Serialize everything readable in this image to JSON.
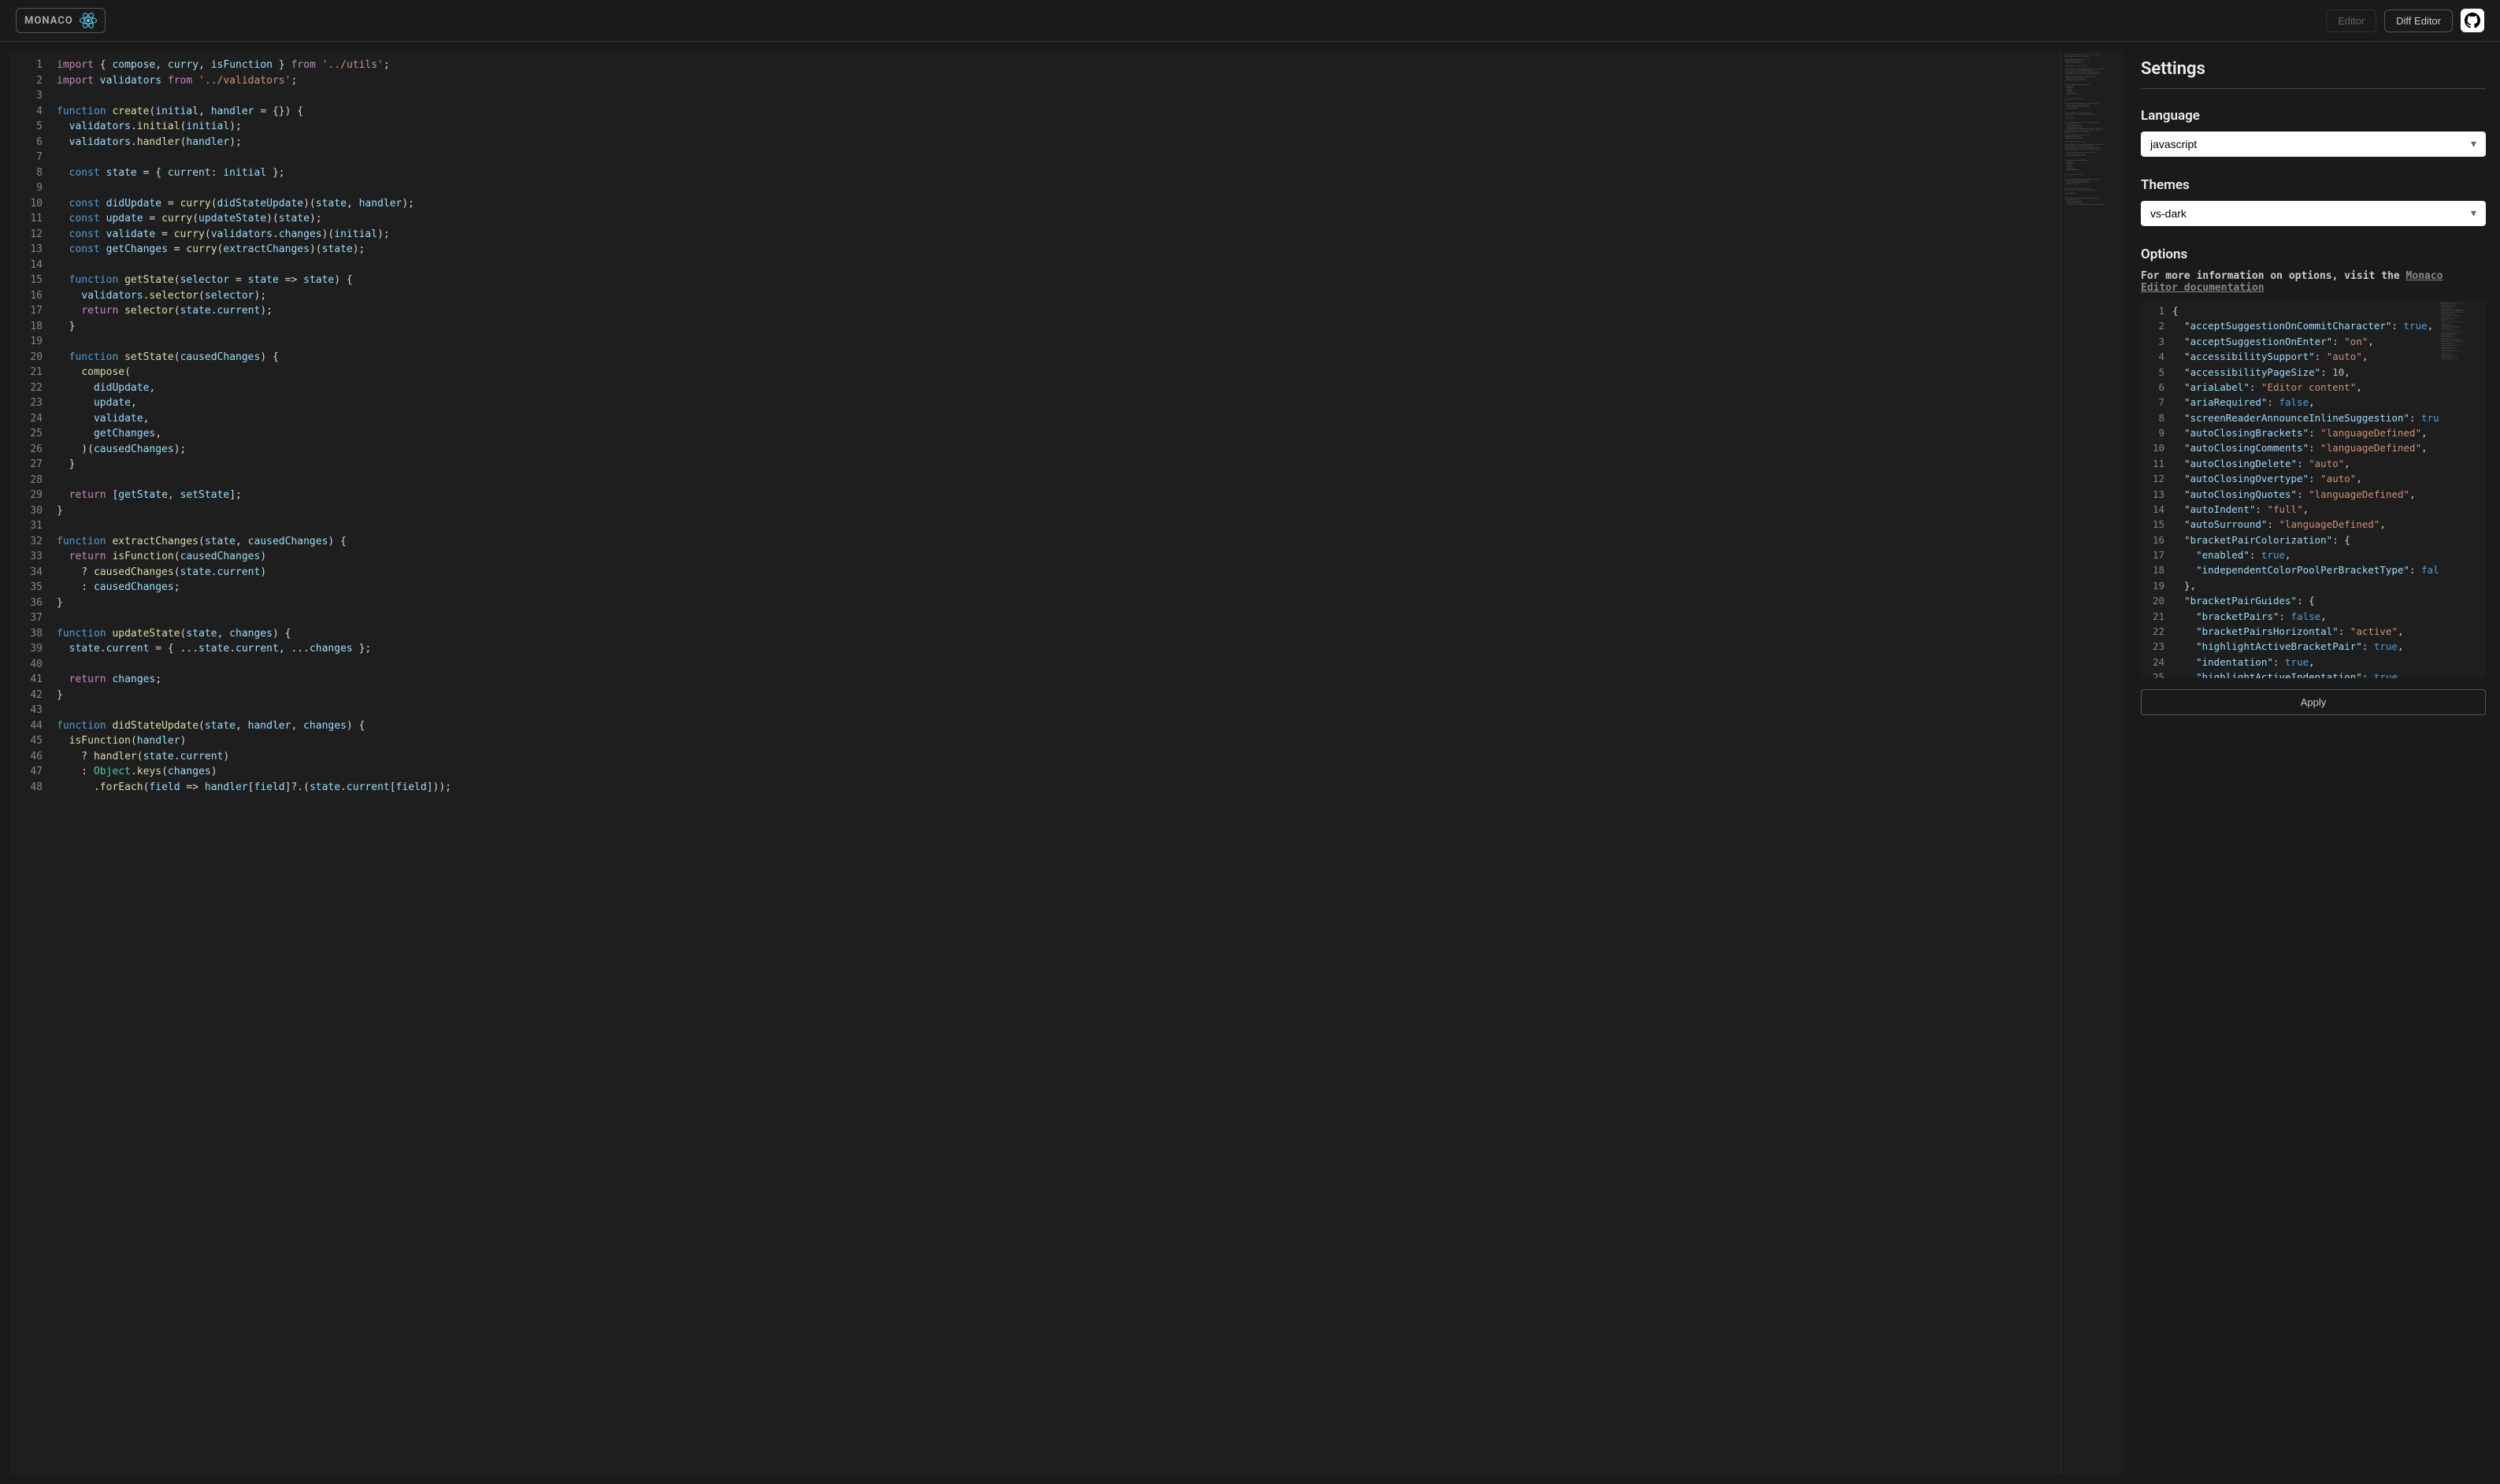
{
  "header": {
    "logo_text": "MONACO",
    "editor_btn": "Editor",
    "diff_btn": "Diff Editor"
  },
  "settings": {
    "title": "Settings",
    "language_label": "Language",
    "language_value": "javascript",
    "themes_label": "Themes",
    "themes_value": "vs-dark",
    "options_label": "Options",
    "options_info_prefix": "For more information on options, visit the ",
    "options_link_text": "Monaco Editor documentation",
    "apply_label": "Apply"
  },
  "main_code_lines": [
    [
      [
        "kw",
        "import"
      ],
      [
        "punct",
        " { "
      ],
      [
        "prop",
        "compose"
      ],
      [
        "punct",
        ", "
      ],
      [
        "prop",
        "curry"
      ],
      [
        "punct",
        ", "
      ],
      [
        "prop",
        "isFunction"
      ],
      [
        "punct",
        " } "
      ],
      [
        "kw",
        "from"
      ],
      [
        "punct",
        " "
      ],
      [
        "str",
        "'../utils'"
      ],
      [
        "punct",
        ";"
      ]
    ],
    [
      [
        "kw",
        "import"
      ],
      [
        "punct",
        " "
      ],
      [
        "prop",
        "validators"
      ],
      [
        "punct",
        " "
      ],
      [
        "kw",
        "from"
      ],
      [
        "punct",
        " "
      ],
      [
        "str",
        "'../validators'"
      ],
      [
        "punct",
        ";"
      ]
    ],
    [],
    [
      [
        "kw2",
        "function"
      ],
      [
        "punct",
        " "
      ],
      [
        "fn",
        "create"
      ],
      [
        "punct",
        "("
      ],
      [
        "prop",
        "initial"
      ],
      [
        "punct",
        ", "
      ],
      [
        "prop",
        "handler"
      ],
      [
        "punct",
        " = {}) {"
      ]
    ],
    [
      [
        "punct",
        "  "
      ],
      [
        "prop",
        "validators"
      ],
      [
        "punct",
        "."
      ],
      [
        "fn",
        "initial"
      ],
      [
        "punct",
        "("
      ],
      [
        "prop",
        "initial"
      ],
      [
        "punct",
        ");"
      ]
    ],
    [
      [
        "punct",
        "  "
      ],
      [
        "prop",
        "validators"
      ],
      [
        "punct",
        "."
      ],
      [
        "fn",
        "handler"
      ],
      [
        "punct",
        "("
      ],
      [
        "prop",
        "handler"
      ],
      [
        "punct",
        ");"
      ]
    ],
    [],
    [
      [
        "punct",
        "  "
      ],
      [
        "kw2",
        "const"
      ],
      [
        "punct",
        " "
      ],
      [
        "prop",
        "state"
      ],
      [
        "punct",
        " = { "
      ],
      [
        "prop",
        "current"
      ],
      [
        "punct",
        ": "
      ],
      [
        "prop",
        "initial"
      ],
      [
        "punct",
        " };"
      ]
    ],
    [],
    [
      [
        "punct",
        "  "
      ],
      [
        "kw2",
        "const"
      ],
      [
        "punct",
        " "
      ],
      [
        "prop",
        "didUpdate"
      ],
      [
        "punct",
        " = "
      ],
      [
        "fn",
        "curry"
      ],
      [
        "punct",
        "("
      ],
      [
        "prop",
        "didStateUpdate"
      ],
      [
        "punct",
        ")("
      ],
      [
        "prop",
        "state"
      ],
      [
        "punct",
        ", "
      ],
      [
        "prop",
        "handler"
      ],
      [
        "punct",
        ");"
      ]
    ],
    [
      [
        "punct",
        "  "
      ],
      [
        "kw2",
        "const"
      ],
      [
        "punct",
        " "
      ],
      [
        "prop",
        "update"
      ],
      [
        "punct",
        " = "
      ],
      [
        "fn",
        "curry"
      ],
      [
        "punct",
        "("
      ],
      [
        "prop",
        "updateState"
      ],
      [
        "punct",
        ")("
      ],
      [
        "prop",
        "state"
      ],
      [
        "punct",
        ");"
      ]
    ],
    [
      [
        "punct",
        "  "
      ],
      [
        "kw2",
        "const"
      ],
      [
        "punct",
        " "
      ],
      [
        "prop",
        "validate"
      ],
      [
        "punct",
        " = "
      ],
      [
        "fn",
        "curry"
      ],
      [
        "punct",
        "("
      ],
      [
        "prop",
        "validators"
      ],
      [
        "punct",
        "."
      ],
      [
        "prop",
        "changes"
      ],
      [
        "punct",
        ")("
      ],
      [
        "prop",
        "initial"
      ],
      [
        "punct",
        ");"
      ]
    ],
    [
      [
        "punct",
        "  "
      ],
      [
        "kw2",
        "const"
      ],
      [
        "punct",
        " "
      ],
      [
        "prop",
        "getChanges"
      ],
      [
        "punct",
        " = "
      ],
      [
        "fn",
        "curry"
      ],
      [
        "punct",
        "("
      ],
      [
        "prop",
        "extractChanges"
      ],
      [
        "punct",
        ")("
      ],
      [
        "prop",
        "state"
      ],
      [
        "punct",
        ");"
      ]
    ],
    [],
    [
      [
        "punct",
        "  "
      ],
      [
        "kw2",
        "function"
      ],
      [
        "punct",
        " "
      ],
      [
        "fn",
        "getState"
      ],
      [
        "punct",
        "("
      ],
      [
        "prop",
        "selector"
      ],
      [
        "punct",
        " = "
      ],
      [
        "prop",
        "state"
      ],
      [
        "punct",
        " => "
      ],
      [
        "prop",
        "state"
      ],
      [
        "punct",
        ") {"
      ]
    ],
    [
      [
        "punct",
        "    "
      ],
      [
        "prop",
        "validators"
      ],
      [
        "punct",
        "."
      ],
      [
        "fn",
        "selector"
      ],
      [
        "punct",
        "("
      ],
      [
        "prop",
        "selector"
      ],
      [
        "punct",
        ");"
      ]
    ],
    [
      [
        "punct",
        "    "
      ],
      [
        "kw",
        "return"
      ],
      [
        "punct",
        " "
      ],
      [
        "fn",
        "selector"
      ],
      [
        "punct",
        "("
      ],
      [
        "prop",
        "state"
      ],
      [
        "punct",
        "."
      ],
      [
        "prop",
        "current"
      ],
      [
        "punct",
        ");"
      ]
    ],
    [
      [
        "punct",
        "  }"
      ]
    ],
    [],
    [
      [
        "punct",
        "  "
      ],
      [
        "kw2",
        "function"
      ],
      [
        "punct",
        " "
      ],
      [
        "fn",
        "setState"
      ],
      [
        "punct",
        "("
      ],
      [
        "prop",
        "causedChanges"
      ],
      [
        "punct",
        ") {"
      ]
    ],
    [
      [
        "punct",
        "    "
      ],
      [
        "fn",
        "compose"
      ],
      [
        "punct",
        "("
      ]
    ],
    [
      [
        "punct",
        "      "
      ],
      [
        "prop",
        "didUpdate"
      ],
      [
        "punct",
        ","
      ]
    ],
    [
      [
        "punct",
        "      "
      ],
      [
        "prop",
        "update"
      ],
      [
        "punct",
        ","
      ]
    ],
    [
      [
        "punct",
        "      "
      ],
      [
        "prop",
        "validate"
      ],
      [
        "punct",
        ","
      ]
    ],
    [
      [
        "punct",
        "      "
      ],
      [
        "prop",
        "getChanges"
      ],
      [
        "punct",
        ","
      ]
    ],
    [
      [
        "punct",
        "    )("
      ],
      [
        "prop",
        "causedChanges"
      ],
      [
        "punct",
        ");"
      ]
    ],
    [
      [
        "punct",
        "  }"
      ]
    ],
    [],
    [
      [
        "punct",
        "  "
      ],
      [
        "kw",
        "return"
      ],
      [
        "punct",
        " ["
      ],
      [
        "prop",
        "getState"
      ],
      [
        "punct",
        ", "
      ],
      [
        "prop",
        "setState"
      ],
      [
        "punct",
        "];"
      ]
    ],
    [
      [
        "punct",
        "}"
      ]
    ],
    [],
    [
      [
        "kw2",
        "function"
      ],
      [
        "punct",
        " "
      ],
      [
        "fn",
        "extractChanges"
      ],
      [
        "punct",
        "("
      ],
      [
        "prop",
        "state"
      ],
      [
        "punct",
        ", "
      ],
      [
        "prop",
        "causedChanges"
      ],
      [
        "punct",
        ") {"
      ]
    ],
    [
      [
        "punct",
        "  "
      ],
      [
        "kw",
        "return"
      ],
      [
        "punct",
        " "
      ],
      [
        "fn",
        "isFunction"
      ],
      [
        "punct",
        "("
      ],
      [
        "prop",
        "causedChanges"
      ],
      [
        "punct",
        ")"
      ]
    ],
    [
      [
        "punct",
        "    ? "
      ],
      [
        "fn",
        "causedChanges"
      ],
      [
        "punct",
        "("
      ],
      [
        "prop",
        "state"
      ],
      [
        "punct",
        "."
      ],
      [
        "prop",
        "current"
      ],
      [
        "punct",
        ")"
      ]
    ],
    [
      [
        "punct",
        "    : "
      ],
      [
        "prop",
        "causedChanges"
      ],
      [
        "punct",
        ";"
      ]
    ],
    [
      [
        "punct",
        "}"
      ]
    ],
    [],
    [
      [
        "kw2",
        "function"
      ],
      [
        "punct",
        " "
      ],
      [
        "fn",
        "updateState"
      ],
      [
        "punct",
        "("
      ],
      [
        "prop",
        "state"
      ],
      [
        "punct",
        ", "
      ],
      [
        "prop",
        "changes"
      ],
      [
        "punct",
        ") {"
      ]
    ],
    [
      [
        "punct",
        "  "
      ],
      [
        "prop",
        "state"
      ],
      [
        "punct",
        "."
      ],
      [
        "prop",
        "current"
      ],
      [
        "punct",
        " = { ..."
      ],
      [
        "prop",
        "state"
      ],
      [
        "punct",
        "."
      ],
      [
        "prop",
        "current"
      ],
      [
        "punct",
        ", ..."
      ],
      [
        "prop",
        "changes"
      ],
      [
        "punct",
        " };"
      ]
    ],
    [],
    [
      [
        "punct",
        "  "
      ],
      [
        "kw",
        "return"
      ],
      [
        "punct",
        " "
      ],
      [
        "prop",
        "changes"
      ],
      [
        "punct",
        ";"
      ]
    ],
    [
      [
        "punct",
        "}"
      ]
    ],
    [],
    [
      [
        "kw2",
        "function"
      ],
      [
        "punct",
        " "
      ],
      [
        "fn",
        "didStateUpdate"
      ],
      [
        "punct",
        "("
      ],
      [
        "prop",
        "state"
      ],
      [
        "punct",
        ", "
      ],
      [
        "prop",
        "handler"
      ],
      [
        "punct",
        ", "
      ],
      [
        "prop",
        "changes"
      ],
      [
        "punct",
        ") {"
      ]
    ],
    [
      [
        "punct",
        "  "
      ],
      [
        "fn",
        "isFunction"
      ],
      [
        "punct",
        "("
      ],
      [
        "prop",
        "handler"
      ],
      [
        "punct",
        ")"
      ]
    ],
    [
      [
        "punct",
        "    ? "
      ],
      [
        "fn",
        "handler"
      ],
      [
        "punct",
        "("
      ],
      [
        "prop",
        "state"
      ],
      [
        "punct",
        "."
      ],
      [
        "prop",
        "current"
      ],
      [
        "punct",
        ")"
      ]
    ],
    [
      [
        "punct",
        "    : "
      ],
      [
        "type",
        "Object"
      ],
      [
        "punct",
        "."
      ],
      [
        "fn",
        "keys"
      ],
      [
        "punct",
        "("
      ],
      [
        "prop",
        "changes"
      ],
      [
        "punct",
        ")"
      ]
    ],
    [
      [
        "punct",
        "      ."
      ],
      [
        "fn",
        "forEach"
      ],
      [
        "punct",
        "("
      ],
      [
        "prop",
        "field"
      ],
      [
        "punct",
        " => "
      ],
      [
        "prop",
        "handler"
      ],
      [
        "punct",
        "["
      ],
      [
        "prop",
        "field"
      ],
      [
        "punct",
        "]?.("
      ],
      [
        "prop",
        "state"
      ],
      [
        "punct",
        "."
      ],
      [
        "prop",
        "current"
      ],
      [
        "punct",
        "["
      ],
      [
        "prop",
        "field"
      ],
      [
        "punct",
        "]));"
      ]
    ]
  ],
  "options_code_lines": [
    [
      [
        "punct",
        "{"
      ]
    ],
    [
      [
        "punct",
        "  "
      ],
      [
        "prop",
        "\"acceptSuggestionOnCommitCharacter\""
      ],
      [
        "punct",
        ": "
      ],
      [
        "bool",
        "true"
      ],
      [
        "punct",
        ","
      ]
    ],
    [
      [
        "punct",
        "  "
      ],
      [
        "prop",
        "\"acceptSuggestionOnEnter\""
      ],
      [
        "punct",
        ": "
      ],
      [
        "str",
        "\"on\""
      ],
      [
        "punct",
        ","
      ]
    ],
    [
      [
        "punct",
        "  "
      ],
      [
        "prop",
        "\"accessibilitySupport\""
      ],
      [
        "punct",
        ": "
      ],
      [
        "str",
        "\"auto\""
      ],
      [
        "punct",
        ","
      ]
    ],
    [
      [
        "punct",
        "  "
      ],
      [
        "prop",
        "\"accessibilityPageSize\""
      ],
      [
        "punct",
        ": "
      ],
      [
        "num",
        "10"
      ],
      [
        "punct",
        ","
      ]
    ],
    [
      [
        "punct",
        "  "
      ],
      [
        "prop",
        "\"ariaLabel\""
      ],
      [
        "punct",
        ": "
      ],
      [
        "str",
        "\"Editor content\""
      ],
      [
        "punct",
        ","
      ]
    ],
    [
      [
        "punct",
        "  "
      ],
      [
        "prop",
        "\"ariaRequired\""
      ],
      [
        "punct",
        ": "
      ],
      [
        "bool",
        "false"
      ],
      [
        "punct",
        ","
      ]
    ],
    [
      [
        "punct",
        "  "
      ],
      [
        "prop",
        "\"screenReaderAnnounceInlineSuggestion\""
      ],
      [
        "punct",
        ": "
      ],
      [
        "bool",
        "tru"
      ]
    ],
    [
      [
        "punct",
        "  "
      ],
      [
        "prop",
        "\"autoClosingBrackets\""
      ],
      [
        "punct",
        ": "
      ],
      [
        "str",
        "\"languageDefined\""
      ],
      [
        "punct",
        ","
      ]
    ],
    [
      [
        "punct",
        "  "
      ],
      [
        "prop",
        "\"autoClosingComments\""
      ],
      [
        "punct",
        ": "
      ],
      [
        "str",
        "\"languageDefined\""
      ],
      [
        "punct",
        ","
      ]
    ],
    [
      [
        "punct",
        "  "
      ],
      [
        "prop",
        "\"autoClosingDelete\""
      ],
      [
        "punct",
        ": "
      ],
      [
        "str",
        "\"auto\""
      ],
      [
        "punct",
        ","
      ]
    ],
    [
      [
        "punct",
        "  "
      ],
      [
        "prop",
        "\"autoClosingOvertype\""
      ],
      [
        "punct",
        ": "
      ],
      [
        "str",
        "\"auto\""
      ],
      [
        "punct",
        ","
      ]
    ],
    [
      [
        "punct",
        "  "
      ],
      [
        "prop",
        "\"autoClosingQuotes\""
      ],
      [
        "punct",
        ": "
      ],
      [
        "str",
        "\"languageDefined\""
      ],
      [
        "punct",
        ","
      ]
    ],
    [
      [
        "punct",
        "  "
      ],
      [
        "prop",
        "\"autoIndent\""
      ],
      [
        "punct",
        ": "
      ],
      [
        "str",
        "\"full\""
      ],
      [
        "punct",
        ","
      ]
    ],
    [
      [
        "punct",
        "  "
      ],
      [
        "prop",
        "\"autoSurround\""
      ],
      [
        "punct",
        ": "
      ],
      [
        "str",
        "\"languageDefined\""
      ],
      [
        "punct",
        ","
      ]
    ],
    [
      [
        "punct",
        "  "
      ],
      [
        "prop",
        "\"bracketPairColorization\""
      ],
      [
        "punct",
        ": {"
      ]
    ],
    [
      [
        "punct",
        "    "
      ],
      [
        "prop",
        "\"enabled\""
      ],
      [
        "punct",
        ": "
      ],
      [
        "bool",
        "true"
      ],
      [
        "punct",
        ","
      ]
    ],
    [
      [
        "punct",
        "    "
      ],
      [
        "prop",
        "\"independentColorPoolPerBracketType\""
      ],
      [
        "punct",
        ": "
      ],
      [
        "bool",
        "fal"
      ]
    ],
    [
      [
        "punct",
        "  },"
      ]
    ],
    [
      [
        "punct",
        "  "
      ],
      [
        "prop",
        "\"bracketPairGuides\""
      ],
      [
        "punct",
        ": {"
      ]
    ],
    [
      [
        "punct",
        "    "
      ],
      [
        "prop",
        "\"bracketPairs\""
      ],
      [
        "punct",
        ": "
      ],
      [
        "bool",
        "false"
      ],
      [
        "punct",
        ","
      ]
    ],
    [
      [
        "punct",
        "    "
      ],
      [
        "prop",
        "\"bracketPairsHorizontal\""
      ],
      [
        "punct",
        ": "
      ],
      [
        "str",
        "\"active\""
      ],
      [
        "punct",
        ","
      ]
    ],
    [
      [
        "punct",
        "    "
      ],
      [
        "prop",
        "\"highlightActiveBracketPair\""
      ],
      [
        "punct",
        ": "
      ],
      [
        "bool",
        "true"
      ],
      [
        "punct",
        ","
      ]
    ],
    [
      [
        "punct",
        "    "
      ],
      [
        "prop",
        "\"indentation\""
      ],
      [
        "punct",
        ": "
      ],
      [
        "bool",
        "true"
      ],
      [
        "punct",
        ","
      ]
    ],
    [
      [
        "punct",
        "    "
      ],
      [
        "prop",
        "\"highlightActiveIndentation\""
      ],
      [
        "punct",
        ": "
      ],
      [
        "bool",
        "true"
      ]
    ]
  ]
}
